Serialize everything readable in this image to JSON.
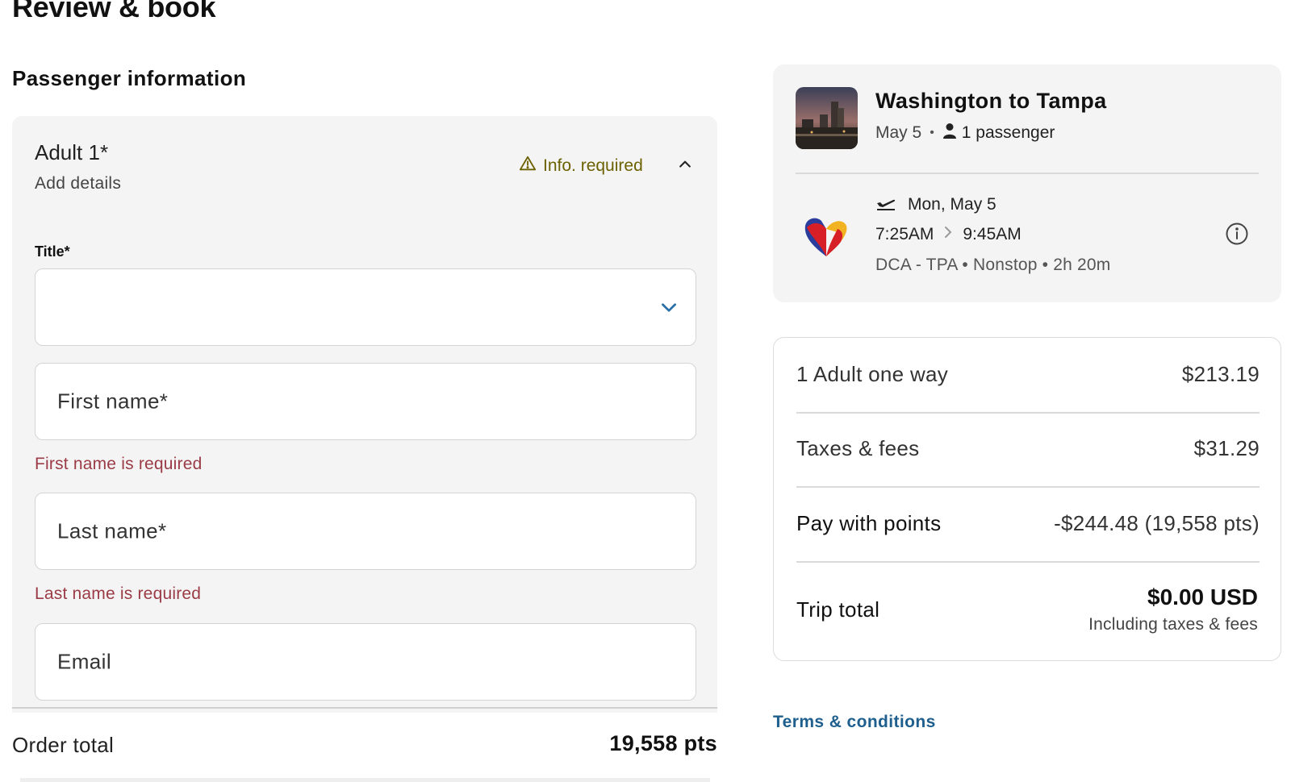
{
  "page": {
    "title": "Review & book"
  },
  "passenger_section": {
    "heading": "Passenger information",
    "card": {
      "title": "Adult 1*",
      "subtitle": "Add details",
      "status": "Info. required",
      "status_color": "#6b6100"
    },
    "form": {
      "title_label": "Title*",
      "title_value": "",
      "first_name_placeholder": "First name*",
      "first_name_error": "First name is required",
      "last_name_placeholder": "Last name*",
      "last_name_error": "Last name is required",
      "email_placeholder": "Email",
      "error_color": "#9a3b46"
    },
    "order_total": {
      "label": "Order total",
      "value": "19,558 pts"
    }
  },
  "trip": {
    "title": "Washington to Tampa",
    "date": "May 5",
    "separator": "•",
    "passengers": "1 passenger",
    "flight": {
      "day": "Mon, May 5",
      "depart": "7:25AM",
      "arrive": "9:45AM",
      "route": "DCA - TPA • Nonstop • 2h 20m"
    }
  },
  "pricing": {
    "rows": [
      {
        "label": "1 Adult one way",
        "value": "$213.19"
      },
      {
        "label": "Taxes & fees",
        "value": "$31.29"
      },
      {
        "label": "Pay with points",
        "value": "-$244.48 (19,558 pts)"
      }
    ],
    "total": {
      "label": "Trip total",
      "value": "$0.00 USD",
      "note": "Including taxes & fees"
    }
  },
  "links": {
    "terms": "Terms & conditions"
  },
  "icons": {
    "warning": "warning-triangle-icon",
    "collapse": "chevron-up-icon",
    "dropdown": "chevron-down-icon",
    "person": "person-icon",
    "departure": "plane-departure-icon",
    "arrow": "chevron-right-icon",
    "info": "info-circle-icon"
  },
  "colors": {
    "link": "#1e5f8e",
    "card_bg": "#f4f4f4",
    "accent_blue": "#2a6fa8"
  }
}
